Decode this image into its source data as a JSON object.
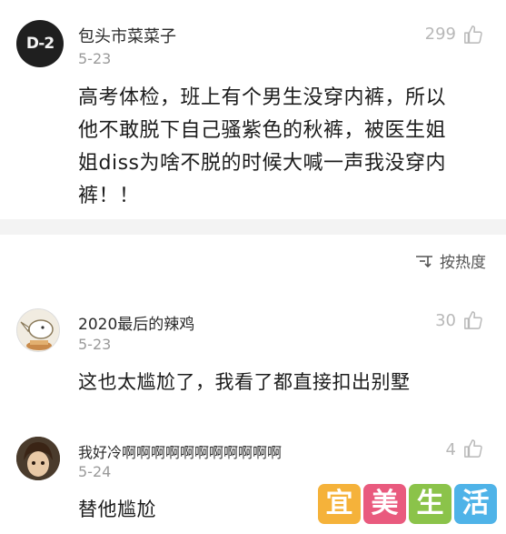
{
  "main_comment": {
    "avatar_text": "D-2",
    "username": "包头市菜菜子",
    "date": "5-23",
    "likes": "299",
    "lines": [
      "高考体检，班上有个男生没穿内裤，所以",
      "他不敢脱下自己骚紫色的秋裤，被医生姐",
      "姐diss为啥不脱的时候大喊一声我没穿内",
      "裤！！"
    ]
  },
  "sort": {
    "label": "按热度",
    "icon": "sort-icon"
  },
  "replies": [
    {
      "username": "2020最后的辣鸡",
      "date": "5-23",
      "likes": "30",
      "text": "这也太尴尬了，我看了都直接扣出别墅"
    },
    {
      "username": "我好冷啊啊啊啊啊啊啊啊啊啊啊",
      "date": "5-24",
      "likes": "4",
      "text": "替他尴尬"
    }
  ],
  "watermark": {
    "chars": [
      "宜",
      "美",
      "生",
      "活"
    ],
    "colors": [
      "#f5b23a",
      "#e95a7e",
      "#8bc34a",
      "#4fb3e8"
    ]
  },
  "colors": {
    "divider": "#f3f3f3",
    "meta_gray": "#9a9a9a",
    "like_gray": "#b8b8b8"
  }
}
